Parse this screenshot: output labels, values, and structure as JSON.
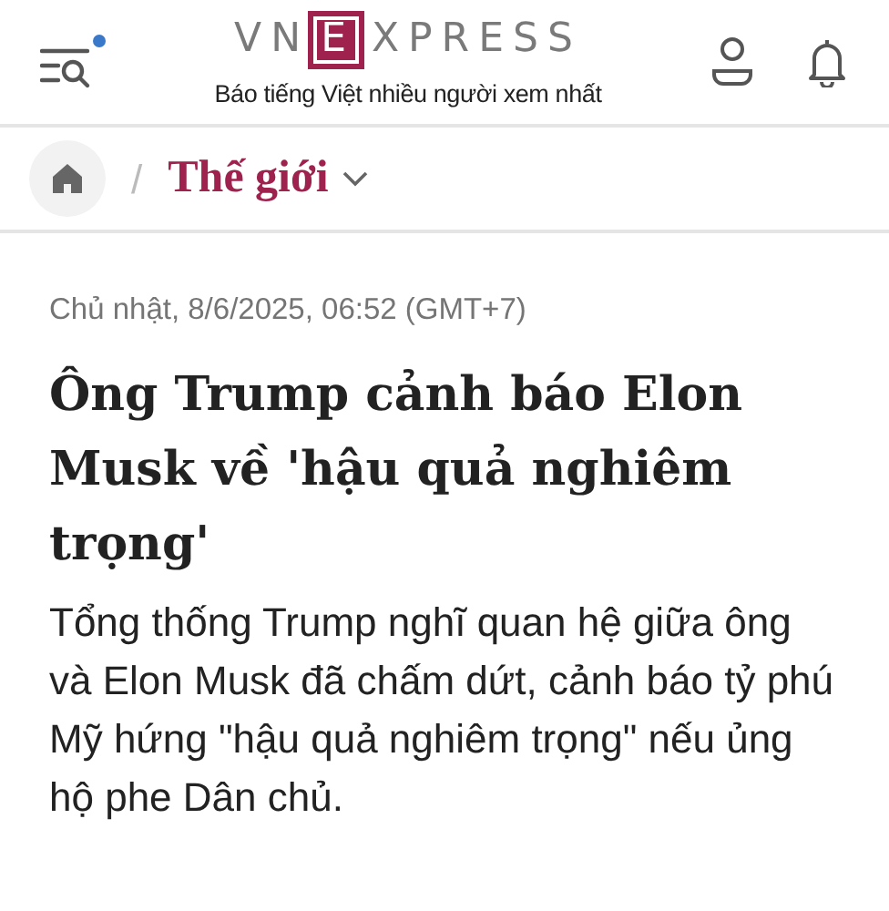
{
  "header": {
    "has_notification_dot": true,
    "logo": {
      "left": "VN",
      "boxed": "E",
      "right": "XPRESS"
    },
    "tagline": "Báo tiếng Việt nhiều người xem nhất"
  },
  "breadcrumb": {
    "separator": "/",
    "section": "Thế giới"
  },
  "article": {
    "date": "Chủ nhật, 8/6/2025, 06:52 (GMT+7)",
    "title": "Ông Trump cảnh báo Elon Musk về 'hậu quả nghiêm trọng'",
    "lead": "Tổng thống Trump nghĩ quan hệ giữa ông và Elon Musk đã chấm dứt, cảnh báo tỷ phú Mỹ hứng \"hậu quả nghiêm trọng\" nếu ủng hộ phe Dân chủ."
  }
}
